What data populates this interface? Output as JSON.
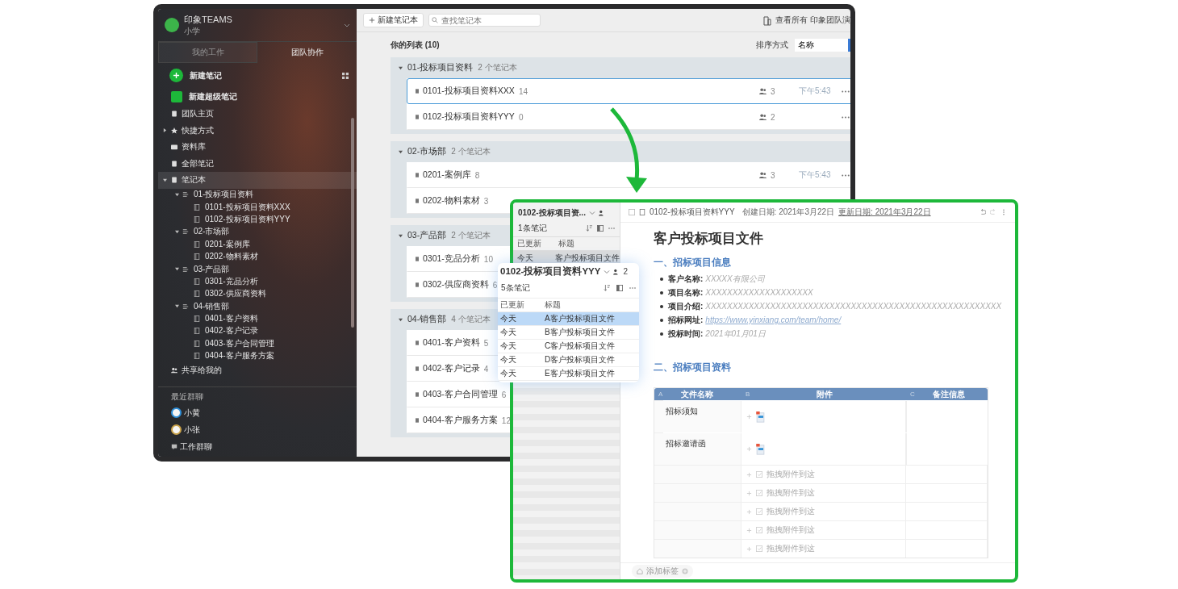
{
  "main_window": {
    "sidebar": {
      "account": {
        "name": "印象TEAMS",
        "sub": "小学"
      },
      "tabs": [
        {
          "label": "我的工作",
          "selected": false
        },
        {
          "label": "团队协作",
          "selected": true
        }
      ],
      "new_note": "新建笔记",
      "new_super_note": "新建超级笔记",
      "nav": [
        {
          "label": "团队主页",
          "kind": "home",
          "selected": false
        },
        {
          "label": "快捷方式",
          "kind": "star",
          "selected": false,
          "expanded": false
        },
        {
          "label": "资料库",
          "kind": "library",
          "selected": false
        },
        {
          "label": "全部笔记",
          "kind": "notes",
          "selected": false
        },
        {
          "label": "笔记本",
          "kind": "notebook",
          "selected": true,
          "expanded": true,
          "children": [
            {
              "label": "01-投标项目资料",
              "expanded": true,
              "children": [
                {
                  "label": "0101-投标项目资料XXX"
                },
                {
                  "label": "0102-投标项目资料YYY"
                }
              ]
            },
            {
              "label": "02-市场部",
              "expanded": true,
              "children": [
                {
                  "label": "0201-案例库"
                },
                {
                  "label": "0202-物料素材"
                }
              ]
            },
            {
              "label": "03-产品部",
              "expanded": true,
              "children": [
                {
                  "label": "0301-竞品分析"
                },
                {
                  "label": "0302-供应商资料"
                }
              ]
            },
            {
              "label": "04-销售部",
              "expanded": true,
              "children": [
                {
                  "label": "0401-客户资料"
                },
                {
                  "label": "0402-客户记录"
                },
                {
                  "label": "0403-客户合同管理"
                },
                {
                  "label": "0404-客户服务方案"
                }
              ]
            }
          ]
        },
        {
          "label": "共享给我的",
          "kind": "shared",
          "selected": false
        }
      ],
      "chats_title": "最近群聊",
      "chats": [
        {
          "name": "小黄",
          "kind": "avatar",
          "color": "#2f8fd8"
        },
        {
          "name": "小张",
          "kind": "avatar",
          "color": "#c9a24a"
        },
        {
          "name": "工作群聊",
          "kind": "group"
        }
      ]
    },
    "toolbar": {
      "new_button": "新建笔记本",
      "search_placeholder": "查找笔记本",
      "right_text": "查看所有 印象团队演"
    },
    "list_title": "你的列表 (10)",
    "sort": {
      "label": "排序方式",
      "value": "名称"
    },
    "stacks": [
      {
        "name": "01-投标项目资料",
        "count": "2 个笔记本",
        "notebooks": [
          {
            "name": "0101-投标项目资料XXX",
            "count": "14",
            "members": "3",
            "time": "下午5:43",
            "selected": true
          },
          {
            "name": "0102-投标项目资料YYY",
            "count": "0",
            "members": "2",
            "selected": false
          }
        ]
      },
      {
        "name": "02-市场部",
        "count": "2 个笔记本",
        "notebooks": [
          {
            "name": "0201-案例库",
            "count": "8",
            "members": "3",
            "time": "下午5:43",
            "selected": false
          },
          {
            "name": "0202-物料素材",
            "count": "3",
            "selected": false
          }
        ]
      },
      {
        "name": "03-产品部",
        "count": "2 个笔记本",
        "notebooks": [
          {
            "name": "0301-竞品分析",
            "count": "10",
            "selected": false
          },
          {
            "name": "0302-供应商资料",
            "count": "6",
            "selected": false
          }
        ]
      },
      {
        "name": "04-销售部",
        "count": "4 个笔记本",
        "notebooks": [
          {
            "name": "0401-客户资料",
            "count": "5",
            "selected": false
          },
          {
            "name": "0402-客户记录",
            "count": "4",
            "selected": false
          },
          {
            "name": "0403-客户合同管理",
            "count": "6",
            "selected": false
          },
          {
            "name": "0404-客户服务方案",
            "count": "12",
            "selected": false
          }
        ]
      }
    ]
  },
  "notebook_window": {
    "list": {
      "title": "0102-投标项目资...",
      "count": "1条笔记",
      "columns": [
        "已更新",
        "标题"
      ],
      "rows": [
        {
          "updated": "今天",
          "title": "客户投标项目文件",
          "selected": true
        }
      ]
    },
    "note": {
      "notebook": "0102-投标项目资料YYY",
      "created": "创建日期: 2021年3月22日",
      "updated": "更新日期: 2021年3月22日",
      "title": "客户投标项目文件",
      "section1": "一、招标项目信息",
      "fields": [
        {
          "label": "客户名称:",
          "value": "XXXXX有限公司",
          "kind": "text"
        },
        {
          "label": "项目名称:",
          "value": "XXXXXXXXXXXXXXXXXXXX",
          "kind": "text"
        },
        {
          "label": "项目介绍:",
          "value": "XXXXXXXXXXXXXXXXXXXXXXXXXXXXXXXXXXXXXXXXXXXXXXXXXXXXXXX",
          "kind": "text"
        },
        {
          "label": "招标网址:",
          "value": "https://www.yinxiang.com/team/home/",
          "kind": "link"
        },
        {
          "label": "投标时间:",
          "value": "2021年01月01日",
          "kind": "text"
        }
      ],
      "section2": "二、招标项目资料",
      "table": {
        "columns": [
          {
            "letter": "A",
            "name": "文件名称"
          },
          {
            "letter": "B",
            "name": "附件"
          },
          {
            "letter": "C",
            "name": "备注信息"
          }
        ],
        "rows": [
          {
            "name": "招标须知",
            "kind": "file"
          },
          {
            "name": "招标邀请函",
            "kind": "file"
          },
          {
            "kind": "drop",
            "hint": "拖拽附件到这"
          },
          {
            "kind": "drop",
            "hint": "拖拽附件到这"
          },
          {
            "kind": "drop",
            "hint": "拖拽附件到这"
          },
          {
            "kind": "drop",
            "hint": "拖拽附件到这"
          },
          {
            "kind": "drop",
            "hint": "拖拽附件到这"
          }
        ]
      },
      "tag_button": "添加标签"
    }
  },
  "popup": {
    "title": "0102-投标项目资料YYY",
    "members": "2",
    "count": "5条笔记",
    "columns": [
      "已更新",
      "标题"
    ],
    "rows": [
      {
        "updated": "今天",
        "title": "A客户投标项目文件",
        "selected": true
      },
      {
        "updated": "今天",
        "title": "B客户投标项目文件",
        "selected": false
      },
      {
        "updated": "今天",
        "title": "C客户投标项目文件",
        "selected": false
      },
      {
        "updated": "今天",
        "title": "D客户投标项目文件",
        "selected": false
      },
      {
        "updated": "今天",
        "title": "E客户投标项目文件",
        "selected": false
      }
    ]
  }
}
